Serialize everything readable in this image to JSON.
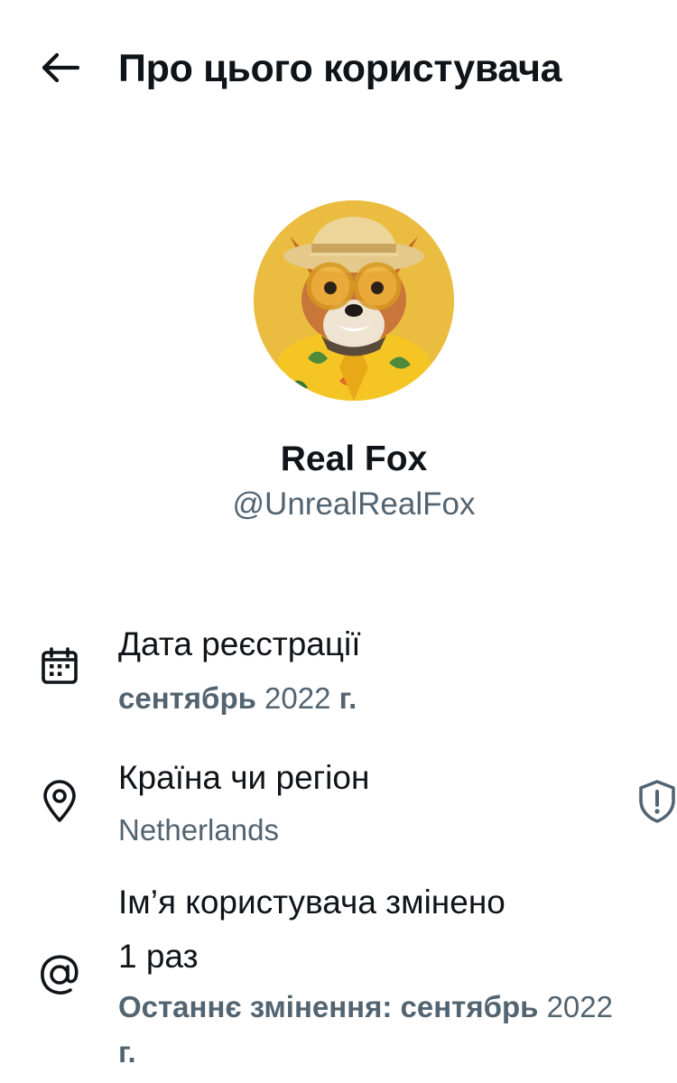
{
  "header": {
    "title": "Про цього користувача",
    "back_icon": "arrow-left-icon"
  },
  "profile": {
    "display_name": "Real Fox",
    "username": "@UnrealRealFox",
    "avatar_description": "fox in straw hat, sunglasses and Hawaiian shirt",
    "avatar_bg": "#e8b93a"
  },
  "rows": {
    "registration": {
      "icon": "calendar-icon",
      "title": "Дата реєстрації",
      "value_bold": "сентябрь",
      "value_rest": " 2022 ",
      "value_suffix": "г."
    },
    "country": {
      "icon": "location-pin-icon",
      "title": "Країна чи регіон",
      "value": "Netherlands",
      "badge_icon": "shield-alert-icon"
    },
    "username_changes": {
      "icon": "at-sign-icon",
      "title_line1": "Ім’я користувача змінено",
      "title_line2": "1 раз",
      "value_bold": "Останнє змінення: сентябрь",
      "value_rest": " 2022",
      "value_line2": "г."
    }
  },
  "colors": {
    "text_primary": "#0f1419",
    "text_secondary": "#536471",
    "background": "#ffffff"
  }
}
